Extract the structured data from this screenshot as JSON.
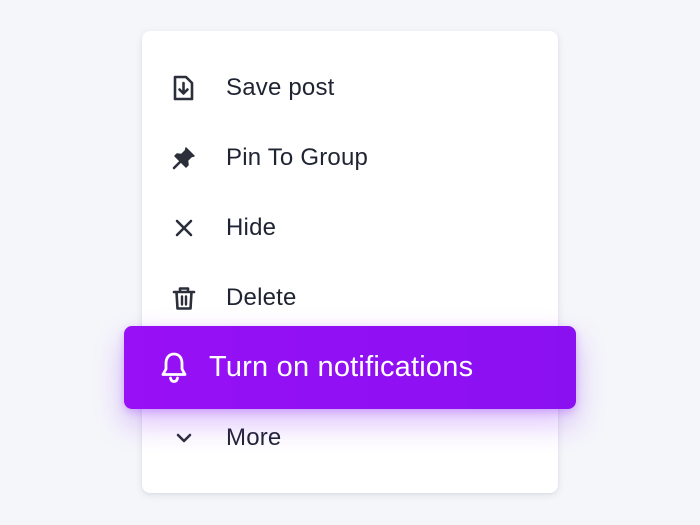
{
  "menu": {
    "items": [
      {
        "label": "Save post",
        "icon": "save-download-icon"
      },
      {
        "label": "Pin To Group",
        "icon": "pin-icon"
      },
      {
        "label": "Hide",
        "icon": "close-icon"
      },
      {
        "label": "Delete",
        "icon": "trash-icon"
      },
      {
        "label": "Turn on notifications",
        "icon": "bell-icon",
        "highlighted": true
      },
      {
        "label": "More",
        "icon": "chevron-down-icon"
      }
    ]
  },
  "colors": {
    "background": "#f5f6fa",
    "menu_bg": "#ffffff",
    "text": "#1f2433",
    "icon": "#2b2f3a",
    "accent": "#9810f5",
    "accent_text": "#ffffff"
  }
}
